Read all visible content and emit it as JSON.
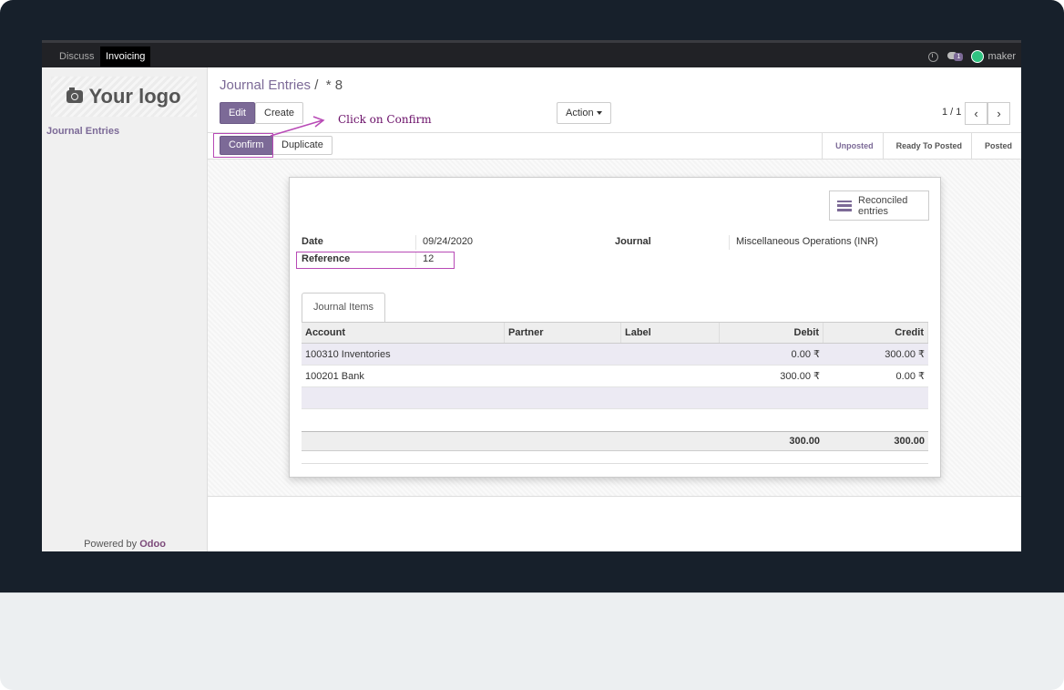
{
  "topbar": {
    "apps": [
      "Discuss",
      "Invoicing"
    ],
    "active_app": "Invoicing",
    "chat_badge": "1",
    "user": "maker"
  },
  "sidebar": {
    "logo_text": "Your logo",
    "menu": [
      "Journal Entries"
    ],
    "powered_prefix": "Powered by",
    "powered_brand": "Odoo"
  },
  "breadcrumb": {
    "parent": "Journal Entries",
    "separator": "/",
    "current": "* 8"
  },
  "toolbar": {
    "edit": "Edit",
    "create": "Create",
    "action": "Action",
    "pager": "1 / 1"
  },
  "statusbar": {
    "confirm": "Confirm",
    "duplicate": "Duplicate",
    "stages": [
      "Unposted",
      "Ready To Posted",
      "Posted"
    ],
    "active_stage": "Unposted"
  },
  "annotation": {
    "text": "Click on Confirm"
  },
  "form": {
    "smart_button": "Reconciled entries",
    "date_label": "Date",
    "date_value": "09/24/2020",
    "reference_label": "Reference",
    "reference_value": "12",
    "journal_label": "Journal",
    "journal_value": "Miscellaneous Operations (INR)"
  },
  "tabs": [
    "Journal Items"
  ],
  "table": {
    "columns": [
      "Account",
      "Partner",
      "Label",
      "Debit",
      "Credit"
    ],
    "rows": [
      [
        "100310 Inventories",
        "",
        "",
        "0.00 ₹",
        "300.00 ₹"
      ],
      [
        "100201 Bank",
        "",
        "",
        "300.00 ₹",
        "0.00 ₹"
      ]
    ],
    "totals": [
      "300.00",
      "300.00"
    ]
  },
  "colors": {
    "brand": "#7c6a97",
    "annotation": "#b84ab6",
    "navbar": "#212226"
  }
}
